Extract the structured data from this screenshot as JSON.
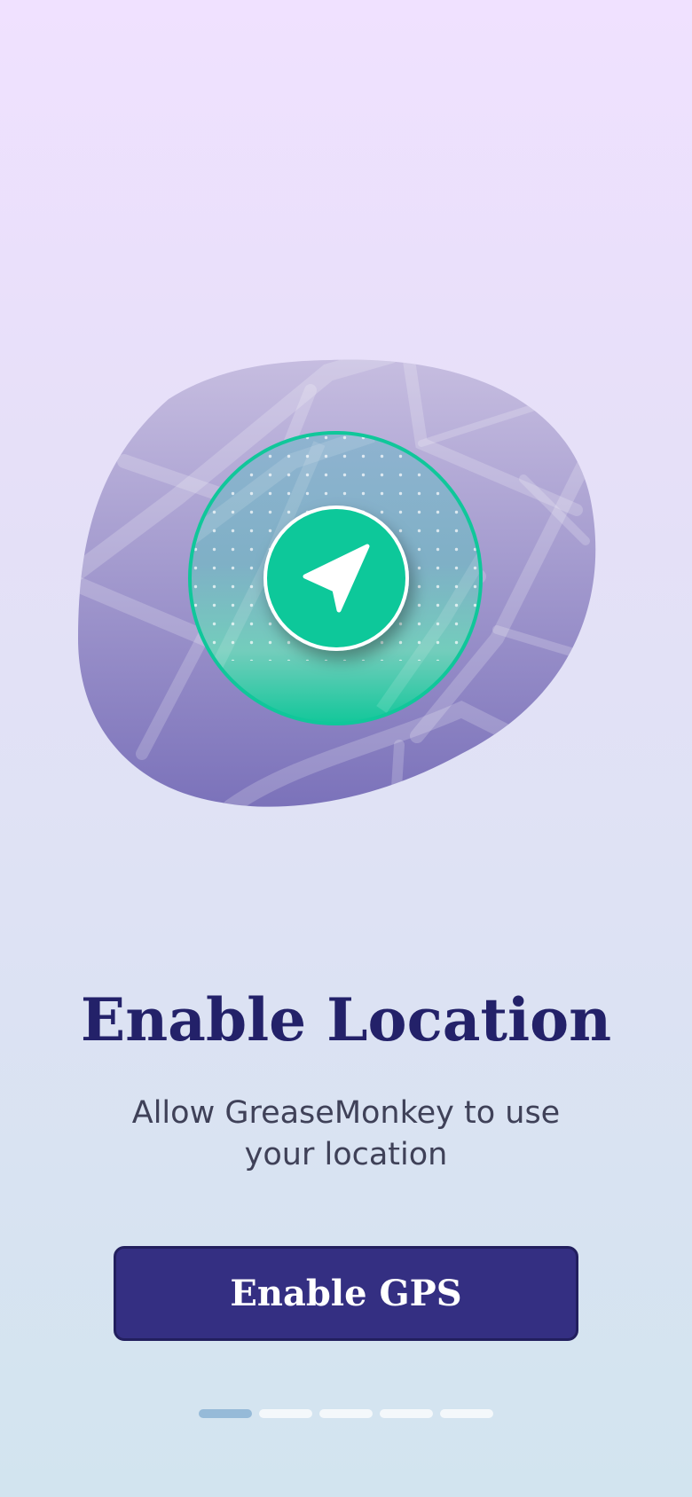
{
  "screen": {
    "title": "Enable Location",
    "subtitle": "Allow GreaseMonkey to use your location",
    "button_label": "Enable GPS"
  },
  "illustration": {
    "icon": "navigation-arrow-icon",
    "map_icon": "map-blob",
    "accent_color": "#0ec89a"
  },
  "pager": {
    "total": 5,
    "active_index": 0
  },
  "colors": {
    "title": "#232169",
    "button": "#342f82",
    "pager_active": "#96bad8",
    "pager_inactive": "#f4f8fb"
  }
}
